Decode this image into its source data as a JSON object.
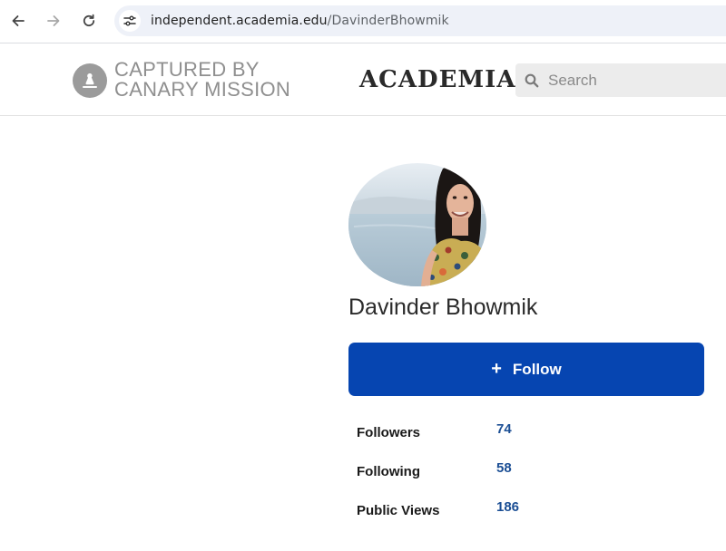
{
  "browser": {
    "url_domain": "independent.academia.edu",
    "url_path": "/DavinderBhowmik"
  },
  "header": {
    "stamp": {
      "line1": "CAPTURED BY",
      "line2": "CANARY MISSION"
    },
    "logo": "ACADEMIA",
    "search_placeholder": "Search"
  },
  "profile": {
    "name": "Davinder Bhowmik",
    "follow_label": "Follow",
    "stats": [
      {
        "label": "Followers",
        "value": "74"
      },
      {
        "label": "Following",
        "value": "58"
      },
      {
        "label": "Public Views",
        "value": "186"
      }
    ]
  },
  "colors": {
    "follow_button": "#0645b1",
    "stat_value": "#1b4e94",
    "stamp_gray": "#8f8f8f"
  },
  "icons": {
    "back": "arrow-left-icon",
    "forward": "arrow-right-icon",
    "reload": "reload-icon",
    "site_info": "tune-icon",
    "stamp": "canary-bird-icon",
    "search": "search-icon",
    "follow": "plus-icon"
  }
}
